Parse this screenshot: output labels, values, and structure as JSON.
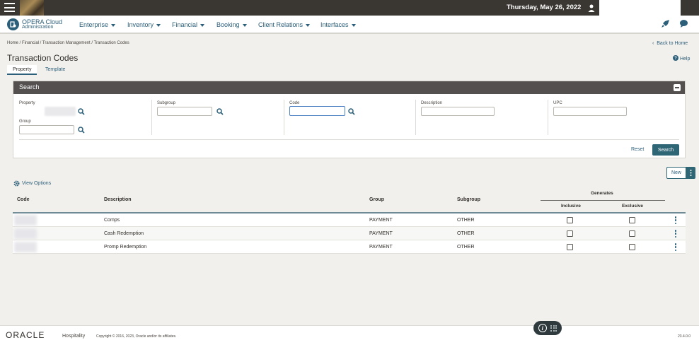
{
  "topbar": {
    "date": "Thursday, May 26, 2022"
  },
  "brand": {
    "title": "OPERA Cloud",
    "subtitle": "Administration"
  },
  "nav": {
    "items": [
      {
        "label": "Enterprise"
      },
      {
        "label": "Inventory"
      },
      {
        "label": "Financial"
      },
      {
        "label": "Booking"
      },
      {
        "label": "Client Relations"
      },
      {
        "label": "Interfaces"
      }
    ]
  },
  "breadcrumb": "Home / Financial / Transaction Management / Transaction Codes",
  "back_home": "Back to Home",
  "page_title": "Transaction Codes",
  "help": "Help",
  "tabs": [
    {
      "label": "Property"
    },
    {
      "label": "Template"
    }
  ],
  "search": {
    "title": "Search",
    "fields": {
      "property": {
        "label": "Property"
      },
      "group": {
        "label": "Group",
        "value": ""
      },
      "subgroup": {
        "label": "Subgroup",
        "value": ""
      },
      "code": {
        "label": "Code",
        "value": ""
      },
      "description": {
        "label": "Description",
        "value": ""
      },
      "upc": {
        "label": "UPC",
        "value": ""
      }
    },
    "reset_label": "Reset",
    "search_label": "Search"
  },
  "new_label": "New",
  "view_options": "View Options",
  "table": {
    "headers": {
      "code": "Code",
      "description": "Description",
      "group": "Group",
      "subgroup": "Subgroup",
      "generates": "Generates",
      "inclusive": "Inclusive",
      "exclusive": "Exclusive"
    },
    "rows": [
      {
        "description": "Comps",
        "group": "PAYMENT",
        "subgroup": "OTHER",
        "inclusive": false,
        "exclusive": false
      },
      {
        "description": "Cash Redemption",
        "group": "PAYMENT",
        "subgroup": "OTHER",
        "inclusive": false,
        "exclusive": false
      },
      {
        "description": "Promp Redemption",
        "group": "PAYMENT",
        "subgroup": "OTHER",
        "inclusive": false,
        "exclusive": false
      }
    ]
  },
  "footer": {
    "oracle": "ORACLE",
    "hospitality": "Hospitality",
    "copyright": "Copyright © 2016, 2023, Oracle and/or its affiliates.",
    "version": "23.4.0.0"
  },
  "colors": {
    "accent": "#2c5f7a",
    "topbar": "#3a3632",
    "search_header": "#545050",
    "primary_button": "#2f6676"
  }
}
